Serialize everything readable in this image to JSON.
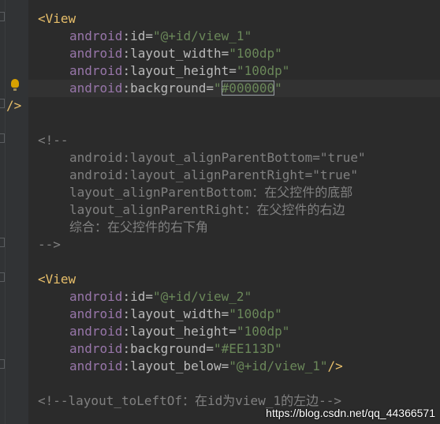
{
  "editor": {
    "lines": [
      {
        "parts": [
          [
            "tag",
            "<View"
          ]
        ]
      },
      {
        "parts": [
          [
            "ns",
            "android"
          ],
          [
            "attr",
            ":id="
          ],
          [
            "val",
            "\"@+id/view_1\""
          ]
        ]
      },
      {
        "parts": [
          [
            "ns",
            "android"
          ],
          [
            "attr",
            ":layout_width="
          ],
          [
            "val",
            "\"100dp\""
          ]
        ]
      },
      {
        "parts": [
          [
            "ns",
            "android"
          ],
          [
            "attr",
            ":layout_height="
          ],
          [
            "val",
            "\"100dp\""
          ]
        ]
      },
      {
        "parts": [
          [
            "ns",
            "android"
          ],
          [
            "attr",
            ":background="
          ],
          [
            "val",
            "\""
          ],
          [
            "valbox",
            "#000000"
          ],
          [
            "val",
            "\""
          ]
        ]
      },
      {
        "parts": [
          [
            "tag",
            "/>"
          ]
        ]
      },
      {
        "parts": []
      },
      {
        "parts": [
          [
            "cmt",
            "<!--"
          ]
        ]
      },
      {
        "parts": [
          [
            "cmt",
            "android:layout_alignParentBottom=\"true\""
          ]
        ]
      },
      {
        "parts": [
          [
            "cmt",
            "android:layout_alignParentRight=\"true\""
          ]
        ]
      },
      {
        "parts": [
          [
            "cmt",
            "layout_alignParentBottom：在父控件的底部"
          ]
        ]
      },
      {
        "parts": [
          [
            "cmt",
            "layout_alignParentRight：在父控件的右边"
          ]
        ]
      },
      {
        "parts": [
          [
            "cmt",
            "综合：在父控件的右下角"
          ]
        ]
      },
      {
        "parts": [
          [
            "cmt",
            "-->"
          ]
        ]
      },
      {
        "parts": []
      },
      {
        "parts": [
          [
            "tag",
            "<View"
          ]
        ]
      },
      {
        "parts": [
          [
            "ns",
            "android"
          ],
          [
            "attr",
            ":id="
          ],
          [
            "val",
            "\"@+id/view_2\""
          ]
        ]
      },
      {
        "parts": [
          [
            "ns",
            "android"
          ],
          [
            "attr",
            ":layout_width="
          ],
          [
            "val",
            "\"100dp\""
          ]
        ]
      },
      {
        "parts": [
          [
            "ns",
            "android"
          ],
          [
            "attr",
            ":layout_height="
          ],
          [
            "val",
            "\"100dp\""
          ]
        ]
      },
      {
        "parts": [
          [
            "ns",
            "android"
          ],
          [
            "attr",
            ":background="
          ],
          [
            "val",
            "\"#EE113D\""
          ]
        ]
      },
      {
        "parts": [
          [
            "ns",
            "android"
          ],
          [
            "attr",
            ":layout_below="
          ],
          [
            "val",
            "\"@+id/view_1\""
          ],
          [
            "tag",
            "/>"
          ]
        ]
      },
      {
        "parts": []
      },
      {
        "parts": [
          [
            "cmt",
            "<!--layout_toLeftOf：在id为view_1的左边-->"
          ]
        ]
      }
    ]
  },
  "icons": [
    "bulb-icon",
    "fold-marker-icon"
  ],
  "colors": {
    "background": "#2b2b2b",
    "gutter": "#313335",
    "tag": "#e8bf6a",
    "namespace": "#9876aa",
    "attribute": "#bababa",
    "value": "#6a8759",
    "comment": "#808080"
  },
  "watermark": "https://blog.csdn.net/qq_44366571"
}
